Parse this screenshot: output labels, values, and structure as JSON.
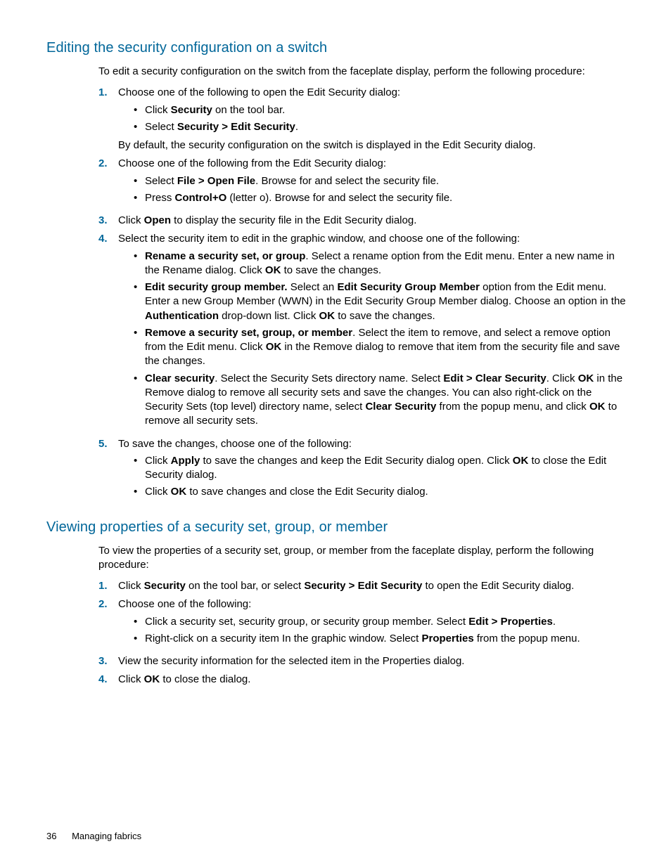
{
  "section1": {
    "heading": "Editing the security configuration on a switch",
    "intro": "To edit a security configuration on the switch from the faceplate display, perform the following procedure:",
    "step1": {
      "lead": "Choose one of the following to open the Edit Security dialog:",
      "b1_pre": "Click ",
      "b1_bold": "Security",
      "b1_post": " on the tool bar.",
      "b2_pre": "Select ",
      "b2_bold": "Security > Edit Security",
      "b2_post": ".",
      "after": "By default, the security configuration on the switch is displayed in the Edit Security dialog."
    },
    "step2": {
      "lead": "Choose one of the following from the Edit Security dialog:",
      "b1_pre": "Select ",
      "b1_bold": "File > Open File",
      "b1_post": ". Browse for and select the security file.",
      "b2_pre": "Press ",
      "b2_bold": "Control+O",
      "b2_post": " (letter o). Browse for and select the security file."
    },
    "step3": {
      "pre": "Click ",
      "bold": "Open",
      "post": " to display the security file in the Edit Security dialog."
    },
    "step4": {
      "lead": "Select the security item to edit in the graphic window, and choose one of the following:",
      "b1_bold": "Rename a security set, or group",
      "b1_mid": ". Select a rename option from the Edit menu. Enter a new name in the Rename dialog. Click ",
      "b1_bold2": "OK",
      "b1_post": " to save the changes.",
      "b2_bold": "Edit security group member.",
      "b2_mid1": " Select an ",
      "b2_bold2": "Edit Security Group Member",
      "b2_mid2": " option from the Edit menu. Enter a new Group Member (WWN) in the Edit Security Group Member dialog. Choose an option in the ",
      "b2_bold3": "Authentication",
      "b2_mid3": " drop-down list. Click ",
      "b2_bold4": "OK",
      "b2_post": " to save the changes.",
      "b3_bold": "Remove a security set, group, or member",
      "b3_mid": ". Select the item to remove, and select a remove option from the Edit menu. Click ",
      "b3_bold2": "OK",
      "b3_post": " in the Remove dialog to remove that item from the security file and save the changes.",
      "b4_bold": "Clear security",
      "b4_mid1": ". Select the Security Sets directory name. Select ",
      "b4_bold2": "Edit > Clear Security",
      "b4_mid2": ". Click ",
      "b4_bold3": "OK",
      "b4_mid3": " in the Remove dialog to remove all security sets and save the changes. You can also right-click on the Security Sets (top level) directory name, select ",
      "b4_bold4": "Clear Security",
      "b4_mid4": " from the popup menu, and click ",
      "b4_bold5": "OK",
      "b4_post": " to remove all security sets."
    },
    "step5": {
      "lead": "To save the changes, choose one of the following:",
      "b1_pre": "Click ",
      "b1_bold": "Apply",
      "b1_mid": " to save the changes and keep the Edit Security dialog open. Click ",
      "b1_bold2": "OK",
      "b1_post": " to close the Edit Security dialog.",
      "b2_pre": "Click ",
      "b2_bold": "OK",
      "b2_post": " to save changes and close the Edit Security dialog."
    }
  },
  "section2": {
    "heading": "Viewing properties of a security set, group, or member",
    "intro": "To view the properties of a security set, group, or member from the faceplate display, perform the following procedure:",
    "step1": {
      "pre": "Click ",
      "bold1": "Security",
      "mid": " on the tool bar, or select ",
      "bold2": "Security > Edit Security",
      "post": " to open the Edit Security dialog."
    },
    "step2": {
      "lead": "Choose one of the following:",
      "b1_pre": "Click a security set, security group, or security group member. Select ",
      "b1_bold": "Edit > Properties",
      "b1_post": ".",
      "b2_pre": "Right-click on a security item In the graphic window. Select ",
      "b2_bold": "Properties",
      "b2_post": " from the popup menu."
    },
    "step3": {
      "text": "View the security information for the selected item in the Properties dialog."
    },
    "step4": {
      "pre": "Click ",
      "bold": "OK",
      "post": " to close the dialog."
    }
  },
  "footer": {
    "page": "36",
    "title": "Managing fabrics"
  }
}
